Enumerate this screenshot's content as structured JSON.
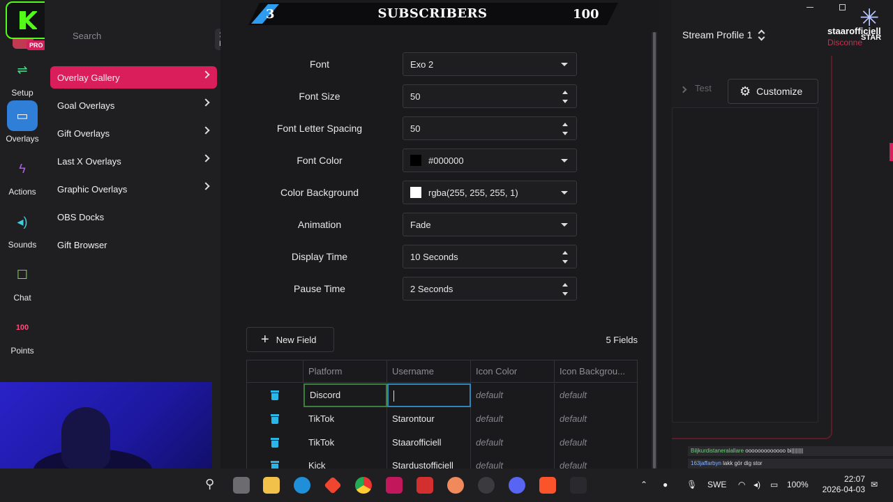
{
  "kick_widget": {
    "count": "12"
  },
  "banner": {
    "left_number": "3",
    "title": "SUBSCRIBERS",
    "right_number": "100"
  },
  "sidebar": {
    "pro_badge": "PRO",
    "search_placeholder": "Search",
    "shortcut": "⌘ K",
    "rail": [
      {
        "label": "Setup",
        "icon": "sliders-icon"
      },
      {
        "label": "Overlays",
        "icon": "monitor-icon",
        "active": true
      },
      {
        "label": "Actions",
        "icon": "lightning-icon"
      },
      {
        "label": "Sounds",
        "icon": "speaker-icon"
      },
      {
        "label": "Chat",
        "icon": "chat-bubbles-icon"
      },
      {
        "label": "Points",
        "icon": "points-100-icon"
      }
    ],
    "menu": [
      {
        "label": "Overlay Gallery",
        "active": true,
        "chevron": true
      },
      {
        "label": "Goal Overlays",
        "chevron": true
      },
      {
        "label": "Gift Overlays",
        "chevron": true
      },
      {
        "label": "Last X Overlays",
        "chevron": true
      },
      {
        "label": "Graphic Overlays",
        "chevron": true
      },
      {
        "label": "OBS Docks",
        "chevron": false
      },
      {
        "label": "Gift Browser",
        "chevron": false
      }
    ]
  },
  "settings": {
    "rows": [
      {
        "label": "Font",
        "value": "Exo 2",
        "control": "select"
      },
      {
        "label": "Font Size",
        "value": "50",
        "control": "spinner"
      },
      {
        "label": "Font Letter Spacing",
        "value": "50",
        "control": "spinner"
      },
      {
        "label": "Font Color",
        "value": "#000000",
        "control": "color",
        "swatch": "#000000"
      },
      {
        "label": "Color Background",
        "value": "rgba(255, 255, 255, 1)",
        "control": "color",
        "swatch": "#ffffff"
      },
      {
        "label": "Animation",
        "value": "Fade",
        "control": "select"
      },
      {
        "label": "Display Time",
        "value": "10 Seconds",
        "control": "spinner"
      },
      {
        "label": "Pause Time",
        "value": "2 Seconds",
        "control": "spinner"
      }
    ],
    "new_field_label": "New Field",
    "fields_count": "5 Fields"
  },
  "fields_table": {
    "columns": [
      "Platform",
      "Username",
      "Icon Color",
      "Icon Backgrou..."
    ],
    "rows": [
      {
        "platform": "Discord",
        "username": "",
        "icon_color": "default",
        "icon_background": "default",
        "editing": true
      },
      {
        "platform": "TikTok",
        "username": "Starontour",
        "icon_color": "default",
        "icon_background": "default"
      },
      {
        "platform": "TikTok",
        "username": "Staarofficiell",
        "icon_color": "default",
        "icon_background": "default"
      },
      {
        "platform": "Kick",
        "username": "Stardustofficiell",
        "icon_color": "default",
        "icon_background": "default"
      }
    ]
  },
  "topbar": {
    "stream_profile": "Stream Profile 1",
    "user_name": "staarofficiell",
    "user_status": "Disconne",
    "logo_text": "STAR"
  },
  "preview": {
    "test_label": "Test",
    "customize_label": "Customize"
  },
  "chat_overlay": [
    {
      "user": "Biljkurdistaneralallare",
      "message": "ooooooooooooo bi||||||||"
    },
    {
      "user": "163jaffarbyn",
      "message": "lakk gör dig stor"
    }
  ],
  "taskbar": {
    "language": "SWE",
    "battery": "100%",
    "time": "22:07",
    "date": "2026-04-03"
  },
  "colors": {
    "accent": "#d91e5b",
    "kick_green": "#53fc18",
    "active_blue": "#2f7fd8",
    "banner_blue": "#2c9bf0"
  }
}
